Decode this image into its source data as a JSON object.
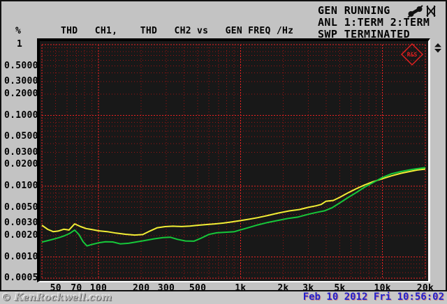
{
  "status_panel": {
    "line1": "GEN RUNNING",
    "line2": "ANL 1:TERM 2:TERM",
    "line3": "SWP TERMINATED",
    "icons": [
      "phone-muted-icon",
      "keyboard-disabled-icon",
      "scroll-updown-icon"
    ]
  },
  "title_row": {
    "unit": "%",
    "top_scale": "1",
    "trace_title": "THD   CH1,    THD   CH2 vs   GEN FREQ /Hz"
  },
  "footer": {
    "watermark": "© KenRockwell.com",
    "timestamp": "Feb 10 2012 Fri 10:56:02"
  },
  "colors": {
    "panel_bg": "#c3c3c3",
    "plot_bg": "#181818",
    "grid_major": "#ee2222",
    "grid_minor": "#a01212",
    "trace_ch1": "#f2ee35",
    "trace_ch2": "#16c83a",
    "logo_red": "#e02020",
    "timestamp_blue": "#2323cd",
    "text": "#000000"
  },
  "chart_data": {
    "type": "line",
    "title": "THD CH1, THD CH2 vs GEN FREQ /Hz",
    "grid": "full log-log dotted red grid, major decade lines brighter",
    "legend": "none",
    "x_axis": {
      "label": "GEN FREQ /Hz",
      "scale": "log",
      "min": 40,
      "max": 20000,
      "ticks": [
        {
          "v": 50,
          "label": "50"
        },
        {
          "v": 70,
          "label": "70"
        },
        {
          "v": 100,
          "label": "100"
        },
        {
          "v": 200,
          "label": "200"
        },
        {
          "v": 300,
          "label": "300"
        },
        {
          "v": 500,
          "label": "500"
        },
        {
          "v": 1000,
          "label": "1k"
        },
        {
          "v": 2000,
          "label": "2k"
        },
        {
          "v": 3000,
          "label": "3k"
        },
        {
          "v": 5000,
          "label": "5k"
        },
        {
          "v": 10000,
          "label": "10k"
        },
        {
          "v": 20000,
          "label": "20k"
        }
      ]
    },
    "y_axis": {
      "label": "%",
      "scale": "log",
      "min": 0.0005,
      "max": 1,
      "ticks": [
        {
          "v": 1,
          "label": "1"
        },
        {
          "v": 0.5,
          "label": "0.5000"
        },
        {
          "v": 0.3,
          "label": "0.3000"
        },
        {
          "v": 0.2,
          "label": "0.2000"
        },
        {
          "v": 0.1,
          "label": "0.1000"
        },
        {
          "v": 0.05,
          "label": "0.0500"
        },
        {
          "v": 0.03,
          "label": "0.0300"
        },
        {
          "v": 0.02,
          "label": "0.0200"
        },
        {
          "v": 0.01,
          "label": "0.0100"
        },
        {
          "v": 0.005,
          "label": "0.0050"
        },
        {
          "v": 0.003,
          "label": "0.0030"
        },
        {
          "v": 0.002,
          "label": "0.0020"
        },
        {
          "v": 0.001,
          "label": "0.0010"
        },
        {
          "v": 0.0005,
          "label": "0.0005"
        }
      ]
    },
    "series": [
      {
        "name": "THD CH1",
        "color": "#f2ee35",
        "points": [
          [
            40,
            0.0028
          ],
          [
            44,
            0.00245
          ],
          [
            48,
            0.00228
          ],
          [
            52,
            0.00232
          ],
          [
            57,
            0.00246
          ],
          [
            62,
            0.0024
          ],
          [
            68,
            0.00293
          ],
          [
            75,
            0.00268
          ],
          [
            82,
            0.00252
          ],
          [
            91,
            0.00243
          ],
          [
            100,
            0.00234
          ],
          [
            115,
            0.00228
          ],
          [
            133,
            0.00217
          ],
          [
            155,
            0.00209
          ],
          [
            180,
            0.00204
          ],
          [
            205,
            0.00207
          ],
          [
            230,
            0.00232
          ],
          [
            260,
            0.00259
          ],
          [
            295,
            0.00268
          ],
          [
            335,
            0.00272
          ],
          [
            385,
            0.00269
          ],
          [
            440,
            0.00273
          ],
          [
            505,
            0.00281
          ],
          [
            580,
            0.00287
          ],
          [
            660,
            0.00293
          ],
          [
            760,
            0.00301
          ],
          [
            870,
            0.00312
          ],
          [
            1000,
            0.00326
          ],
          [
            1150,
            0.00341
          ],
          [
            1320,
            0.00359
          ],
          [
            1550,
            0.00385
          ],
          [
            1850,
            0.00418
          ],
          [
            2200,
            0.00447
          ],
          [
            2600,
            0.00468
          ],
          [
            3000,
            0.00502
          ],
          [
            3400,
            0.00528
          ],
          [
            3700,
            0.00552
          ],
          [
            4000,
            0.00612
          ],
          [
            4500,
            0.00628
          ],
          [
            5000,
            0.00695
          ],
          [
            5700,
            0.00805
          ],
          [
            6500,
            0.00915
          ],
          [
            7400,
            0.0103
          ],
          [
            8500,
            0.0115
          ],
          [
            10000,
            0.01275
          ],
          [
            11500,
            0.01395
          ],
          [
            13500,
            0.0152
          ],
          [
            15500,
            0.0161
          ],
          [
            17500,
            0.0169
          ],
          [
            20000,
            0.01745
          ]
        ]
      },
      {
        "name": "THD CH2",
        "color": "#16c83a",
        "points": [
          [
            40,
            0.00162
          ],
          [
            44,
            0.0017
          ],
          [
            48,
            0.00178
          ],
          [
            53,
            0.00188
          ],
          [
            58,
            0.002
          ],
          [
            63,
            0.00216
          ],
          [
            68,
            0.0024
          ],
          [
            73,
            0.00207
          ],
          [
            78,
            0.00164
          ],
          [
            83,
            0.00143
          ],
          [
            90,
            0.0015
          ],
          [
            100,
            0.00158
          ],
          [
            112,
            0.00164
          ],
          [
            126,
            0.00163
          ],
          [
            143,
            0.00153
          ],
          [
            163,
            0.00156
          ],
          [
            185,
            0.00163
          ],
          [
            210,
            0.0017
          ],
          [
            245,
            0.0018
          ],
          [
            285,
            0.00188
          ],
          [
            320,
            0.0019
          ],
          [
            360,
            0.00177
          ],
          [
            410,
            0.00168
          ],
          [
            470,
            0.00167
          ],
          [
            530,
            0.00185
          ],
          [
            600,
            0.00208
          ],
          [
            680,
            0.00219
          ],
          [
            780,
            0.00223
          ],
          [
            900,
            0.00227
          ],
          [
            1000,
            0.00241
          ],
          [
            1150,
            0.00261
          ],
          [
            1320,
            0.00283
          ],
          [
            1550,
            0.00307
          ],
          [
            1850,
            0.00329
          ],
          [
            2150,
            0.00349
          ],
          [
            2550,
            0.00367
          ],
          [
            3000,
            0.00401
          ],
          [
            3400,
            0.00424
          ],
          [
            3900,
            0.00448
          ],
          [
            4400,
            0.00494
          ],
          [
            5000,
            0.0058
          ],
          [
            5700,
            0.00688
          ],
          [
            6500,
            0.00808
          ],
          [
            7400,
            0.00955
          ],
          [
            8500,
            0.01115
          ],
          [
            10000,
            0.0133
          ],
          [
            11500,
            0.0149
          ],
          [
            13500,
            0.0161
          ],
          [
            16000,
            0.0172
          ],
          [
            18000,
            0.0178
          ],
          [
            20000,
            0.0183
          ]
        ]
      }
    ],
    "annotations": [
      {
        "type": "logo",
        "text": "R&S",
        "color": "#e02020",
        "position": "top-right-inside-plot"
      }
    ]
  }
}
